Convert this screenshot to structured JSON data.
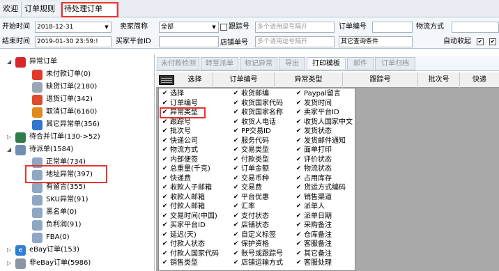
{
  "tabs": [
    {
      "label": "欢迎"
    },
    {
      "label": "订单规则"
    },
    {
      "label": "待处理订单"
    }
  ],
  "filters": {
    "start_time_label": "开始时间",
    "start_time_value": "2018-12-31",
    "end_time_label": "结束时间",
    "end_time_value": "2019-01-30 23:59:!",
    "seller_label": "卖家简称",
    "seller_value": "全部",
    "seller_platform_label": "买家平台ID",
    "tracking_label": "跟踪号",
    "tracking_placeholder": "多个请用逗号隔开",
    "store_order_label": "店铺单号",
    "store_order_placeholder": "多个请用逗号隔开",
    "order_no_label": "订单编号",
    "other_query_label": "其它查询条件",
    "shipping_label": "物流方式",
    "auto_collapse_label": "自动收起",
    "auto_collapse_checked": "✔",
    "second_check": "✔"
  },
  "tree": {
    "nodes": [
      {
        "label": "异常订单",
        "icon": "no-entry-icon",
        "color": "#d9262b",
        "expander": "◢"
      },
      {
        "label": "未付款订单(0)",
        "icon": "arrow-right-icon",
        "color": "#e03a2c"
      },
      {
        "label": "缺货订单(2180)",
        "icon": "box-icon",
        "color": "#9aa6b6"
      },
      {
        "label": "退货订单(342)",
        "icon": "return-icon",
        "color": "#e04a2c"
      },
      {
        "label": "取消订单(6160)",
        "icon": "warning-icon",
        "color": "#e08a1c"
      },
      {
        "label": "其它异常单(356)",
        "icon": "help-icon",
        "color": "#2f77d0"
      },
      {
        "label": "待合并订单(130->52)",
        "icon": "merge-icon",
        "color": "#2e7d4a",
        "expander": "▷"
      },
      {
        "label": "待派单(1584)",
        "icon": "person-icon",
        "color": "#6f8fb0",
        "expander": "◢"
      },
      {
        "label": "正常单(734)",
        "icon": "person-icon",
        "color": "#8fa7c2"
      },
      {
        "label": "地址异常(397)",
        "icon": "person-icon",
        "color": "#8fa7c2"
      },
      {
        "label": "有留言(355)",
        "icon": "person-icon",
        "color": "#8fa7c2"
      },
      {
        "label": "SKU异常(91)",
        "icon": "person-icon",
        "color": "#8fa7c2"
      },
      {
        "label": "黑名单(0)",
        "icon": "person-icon",
        "color": "#8fa7c2"
      },
      {
        "label": "负利润(91)",
        "icon": "person-icon",
        "color": "#8fa7c2"
      },
      {
        "label": "FBA(0)",
        "icon": "person-icon",
        "color": "#8fa7c2"
      },
      {
        "label": "eBay订单(153)",
        "icon": "ebay-icon",
        "color": "#2f7fd3",
        "expander": "▷",
        "glyph": "e"
      },
      {
        "label": "非eBay订单(5986)",
        "icon": "store-icon",
        "color": "#8a96a6",
        "expander": "▷"
      }
    ]
  },
  "toolbar": {
    "buttons": [
      {
        "label": "未付款检测",
        "enabled": false
      },
      {
        "label": "转至派单",
        "enabled": false
      },
      {
        "label": "标记异常",
        "enabled": false
      },
      {
        "label": "导出",
        "enabled": false
      },
      {
        "label": "打印模板",
        "enabled": true
      },
      {
        "label": "邮件",
        "enabled": false
      },
      {
        "label": "订单归档",
        "enabled": false
      }
    ]
  },
  "columns": [
    {
      "label": "选择"
    },
    {
      "label": "订单编号"
    },
    {
      "label": "异常类型"
    },
    {
      "label": "跟踪号"
    },
    {
      "label": "批次号"
    },
    {
      "label": "快递"
    }
  ],
  "chooser": {
    "check": "✔",
    "col1": [
      "选择",
      "订单编号",
      "异常类型",
      "跟踪号",
      "批次号",
      "快递公司",
      "物流方式",
      "内部便签",
      "总重量(千克)",
      "快递费",
      "收款人子邮箱",
      "收款人邮箱",
      "付款人邮箱",
      "交易时间(中国)",
      "买家平台ID",
      "延迟(天)",
      "付款人状态",
      "付款人国家代码",
      "销售类型"
    ],
    "col2": [
      "收货邮编",
      "收货国家代码",
      "收货国家名称",
      "收货人电话",
      "PP交易ID",
      "服务代码",
      "交易类型",
      "付款类型",
      "订单金额",
      "交易币种",
      "交易费",
      "平台优惠",
      "汇率",
      "支付状态",
      "店铺状态",
      "自定义标签",
      "保护资格",
      "账号或跟踪号",
      "店铺运输方式"
    ],
    "col3": [
      "Paypal留言",
      "发货时间",
      "卖家平台ID",
      "收货人国家中文",
      "发货状态",
      "发货邮件通知",
      "面单打印",
      "评价状态",
      "物流状态",
      "占用库存",
      "货运方式编码",
      "销售渠道",
      "派单人",
      "派单日期",
      "采购备注",
      "仓库备注",
      "客服备注",
      "其它备注",
      "客服处理"
    ]
  }
}
